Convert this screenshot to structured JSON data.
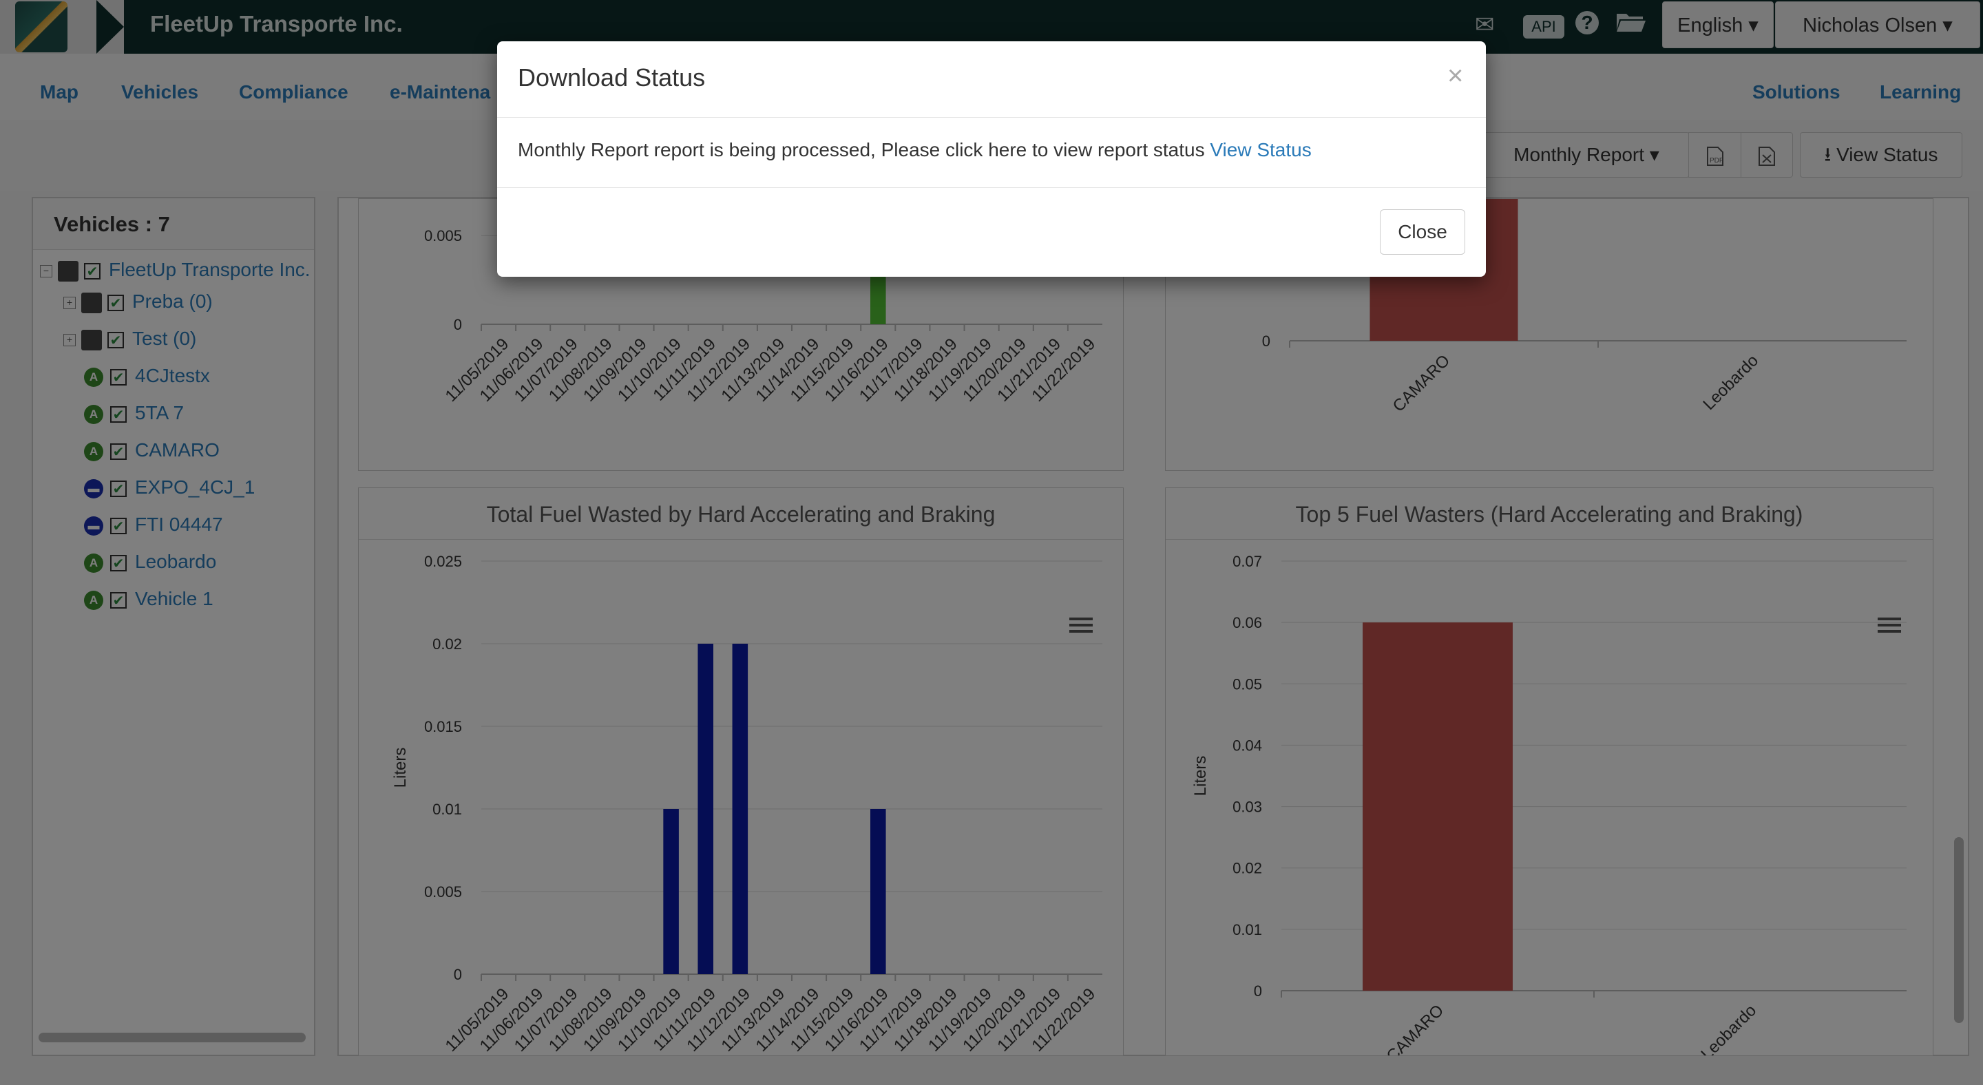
{
  "header": {
    "brand": "FleetUp Transporte Inc.",
    "api_label": "API",
    "help_label": "?",
    "language": "English ▾",
    "user": "Nicholas Olsen ▾"
  },
  "nav": {
    "left": [
      "Map",
      "Vehicles",
      "Compliance",
      "e-Maintena"
    ],
    "right": [
      "Solutions",
      "Learning"
    ]
  },
  "toolbar": {
    "report_select": "Monthly Report ▾",
    "view_status_label": "View Status"
  },
  "sidebar": {
    "title": "Vehicles : 7",
    "root": "FleetUp Transporte Inc.",
    "groups": [
      "Preba (0)",
      "Test (0)"
    ],
    "vehicles": [
      {
        "name": "4CJtestx",
        "status": "active"
      },
      {
        "name": "5TA 7",
        "status": "active"
      },
      {
        "name": "CAMARO",
        "status": "active"
      },
      {
        "name": "EXPO_4CJ_1",
        "status": "stopped"
      },
      {
        "name": "FTI 04447",
        "status": "stopped"
      },
      {
        "name": "Leobardo",
        "status": "active"
      },
      {
        "name": "Vehicle 1",
        "status": "active"
      }
    ]
  },
  "charts": {
    "bottom_left_title": "Total Fuel Wasted by Hard Accelerating and Braking",
    "bottom_right_title": "Top 5 Fuel Wasters (Hard Accelerating and Braking)"
  },
  "chart_data": [
    {
      "type": "bar",
      "categories": [
        "11/05/2019",
        "11/06/2019",
        "11/07/2019",
        "11/08/2019",
        "11/09/2019",
        "11/10/2019",
        "11/11/2019",
        "11/12/2019",
        "11/13/2019",
        "11/14/2019",
        "11/15/2019",
        "11/16/2019",
        "11/17/2019",
        "11/18/2019",
        "11/19/2019",
        "11/20/2019",
        "11/21/2019",
        "11/22/2019"
      ],
      "values": [
        0,
        0,
        0,
        0,
        0,
        0,
        0,
        0,
        0,
        0,
        0,
        0.003,
        0,
        0,
        0,
        0,
        0,
        0
      ],
      "yticks": [
        "0",
        "0.005"
      ],
      "color": "#52c234",
      "title": "",
      "ylabel": ""
    },
    {
      "type": "bar",
      "categories": [
        "CAMARO",
        "Leobardo"
      ],
      "values": [
        1,
        0
      ],
      "yticks": [
        "0"
      ],
      "color": "#c0504d",
      "title": "",
      "ylabel": ""
    },
    {
      "type": "bar",
      "categories": [
        "11/05/2019",
        "11/06/2019",
        "11/07/2019",
        "11/08/2019",
        "11/09/2019",
        "11/10/2019",
        "11/11/2019",
        "11/12/2019",
        "11/13/2019",
        "11/14/2019",
        "11/15/2019",
        "11/16/2019",
        "11/17/2019",
        "11/18/2019",
        "11/19/2019",
        "11/20/2019",
        "11/21/2019",
        "11/22/2019"
      ],
      "values": [
        0,
        0,
        0,
        0,
        0,
        0.01,
        0.02,
        0.02,
        0,
        0,
        0,
        0.01,
        0,
        0,
        0,
        0,
        0,
        0
      ],
      "ylim": [
        0,
        0.025
      ],
      "yticks": [
        "0",
        "0.005",
        "0.01",
        "0.015",
        "0.02",
        "0.025"
      ],
      "color": "#0a1aa8",
      "title": "Total Fuel Wasted by Hard Accelerating and Braking",
      "ylabel": "Liters"
    },
    {
      "type": "bar",
      "categories": [
        "CAMARO",
        "Leobardo"
      ],
      "values": [
        0.06,
        0
      ],
      "ylim": [
        0,
        0.07
      ],
      "yticks": [
        "0",
        "0.01",
        "0.02",
        "0.03",
        "0.04",
        "0.05",
        "0.06",
        "0.07"
      ],
      "color": "#c0504d",
      "title": "Top 5 Fuel Wasters (Hard Accelerating and Braking)",
      "ylabel": "Liters"
    }
  ],
  "modal": {
    "title": "Download Status",
    "close_x": "×",
    "message": "Monthly Report report is being processed, Please click here to view report status ",
    "link": "View Status",
    "close_button": "Close"
  }
}
